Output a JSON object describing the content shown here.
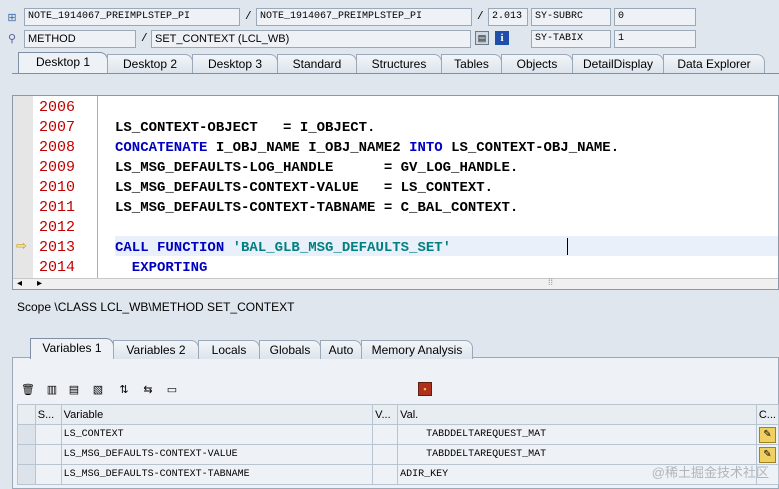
{
  "header": {
    "program1": "NOTE_1914067_PREIMPLSTEP_PI",
    "program2": "NOTE_1914067_PREIMPLSTEP_PI",
    "line_pos": "2.013",
    "sysvar1_name": "SY-SUBRC",
    "sysvar1_value": "0",
    "event_type": "METHOD",
    "event_name": "SET_CONTEXT (LCL_WB)",
    "sysvar2_name": "SY-TABIX",
    "sysvar2_value": "1",
    "separator": "/"
  },
  "desktop_tabs": [
    "Desktop 1",
    "Desktop 2",
    "Desktop 3",
    "Standard",
    "Structures",
    "Tables",
    "Objects",
    "DetailDisplay",
    "Data Explorer"
  ],
  "editor": {
    "line_numbers": [
      "2006",
      "2007",
      "2008",
      "2009",
      "2010",
      "2011",
      "2012",
      "2013",
      "2014"
    ],
    "lines": [
      [],
      [
        {
          "t": "LS_CONTEXT-OBJECT   = I_OBJECT.",
          "c": ""
        }
      ],
      [
        {
          "t": "CONCATENATE",
          "c": "kw"
        },
        {
          "t": " I_OBJ_NAME I_OBJ_NAME2 ",
          "c": ""
        },
        {
          "t": "INTO",
          "c": "kw"
        },
        {
          "t": " LS_CONTEXT-OBJ_NAME.",
          "c": ""
        }
      ],
      [
        {
          "t": "LS_MSG_DEFAULTS-LOG_HANDLE      = GV_LOG_HANDLE.",
          "c": ""
        }
      ],
      [
        {
          "t": "LS_MSG_DEFAULTS-CONTEXT-VALUE   = LS_CONTEXT.",
          "c": ""
        }
      ],
      [
        {
          "t": "LS_MSG_DEFAULTS-CONTEXT-TABNAME = C_BAL_CONTEXT.",
          "c": ""
        }
      ],
      [],
      [
        {
          "t": "CALL FUNCTION",
          "c": "kw"
        },
        {
          "t": " ",
          "c": ""
        },
        {
          "t": "'BAL_GLB_MSG_DEFAULTS_SET'",
          "c": "str"
        }
      ],
      [
        {
          "t": "  EXPORTING",
          "c": "kw"
        }
      ]
    ],
    "current_line_index": 7
  },
  "scope": "Scope \\CLASS LCL_WB\\METHOD SET_CONTEXT",
  "var_tabs": [
    "Variables 1",
    "Variables 2",
    "Locals",
    "Globals",
    "Auto",
    "Memory Analysis"
  ],
  "grid": {
    "headers": [
      "S...",
      "Variable",
      "V...",
      "Val.",
      "C..."
    ],
    "rows": [
      {
        "variable": "LS_CONTEXT",
        "value": "TABDDELTAREQUEST_MAT",
        "indent": true
      },
      {
        "variable": "LS_MSG_DEFAULTS-CONTEXT-VALUE",
        "value": "TABDDELTAREQUEST_MAT",
        "indent": true
      },
      {
        "variable": "LS_MSG_DEFAULTS-CONTEXT-TABNAME",
        "value": "ADIR_KEY",
        "indent": false
      }
    ]
  },
  "watermark": "@稀土掘金技术社区",
  "colors": {
    "keyword": "#0000c0",
    "string": "#008080",
    "line_number": "#c00000"
  }
}
